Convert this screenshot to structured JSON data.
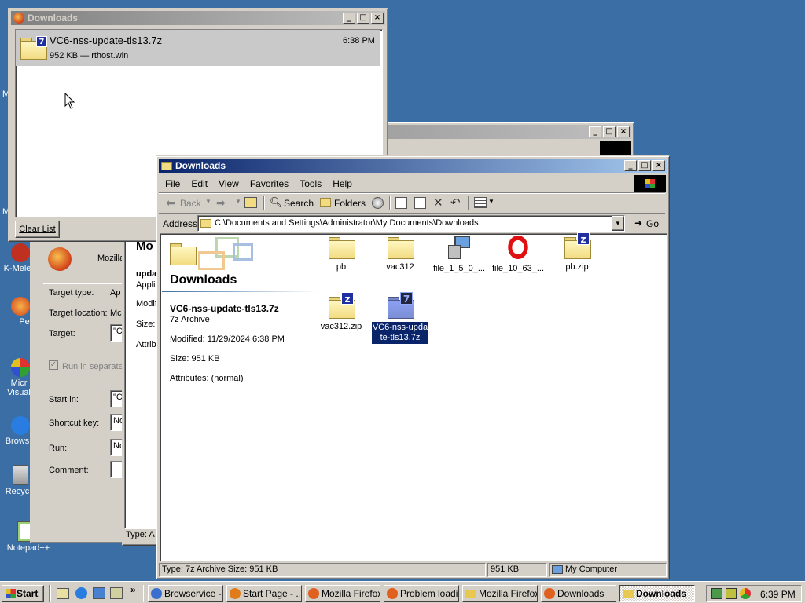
{
  "desktop": {
    "icons": [
      {
        "label": "K-Mele"
      },
      {
        "label": "Pe"
      },
      {
        "label": "Micr Visual"
      },
      {
        "label": "Brows"
      },
      {
        "label": "Recyc"
      },
      {
        "label": "Notepad++"
      }
    ],
    "edge_letters": [
      "M",
      "M"
    ]
  },
  "downloads_manager": {
    "title": "Downloads",
    "item": {
      "name": "VC6-nss-update-tls13.7z",
      "details": "952 KB — rthost.win",
      "time": "6:38 PM"
    },
    "clear_button": "Clear List"
  },
  "properties_window": {
    "app_name": "Mozilla",
    "labels": {
      "target_type": "Target type:",
      "target_location": "Target location:",
      "target": "Target:",
      "run_separate": "Run in separate",
      "start_in": "Start in:",
      "shortcut_key": "Shortcut key:",
      "run": "Run:",
      "comment": "Comment:"
    },
    "values": {
      "target_type": "Ap",
      "target_location": "Mc",
      "target": "\"C",
      "start_in": "\"C",
      "shortcut_key": "No",
      "run": "No"
    }
  },
  "middle_window": {
    "heading": "Mo",
    "title": "upda",
    "type_short": "Applic",
    "modified_label": "Modif",
    "size_label": "Size:",
    "attributes_label": "Attrib",
    "status": "Type: A"
  },
  "explorer": {
    "title": "Downloads",
    "menu": [
      "File",
      "Edit",
      "View",
      "Favorites",
      "Tools",
      "Help"
    ],
    "toolbar": {
      "back": "Back",
      "search": "Search",
      "folders": "Folders"
    },
    "address_label": "Address",
    "address_value": "C:\\Documents and Settings\\Administrator\\My Documents\\Downloads",
    "go_label": "Go",
    "left_panel": {
      "folder_title": "Downloads",
      "file_name": "VC6-nss-update-tls13.7z",
      "file_type": "7z Archive",
      "modified": "Modified: 11/29/2024 6:38 PM",
      "size": "Size: 951 KB",
      "attributes": "Attributes: (normal)"
    },
    "files": [
      {
        "name": "pb",
        "kind": "folder"
      },
      {
        "name": "vac312",
        "kind": "folder"
      },
      {
        "name": "file_1_5_0_...",
        "kind": "installer"
      },
      {
        "name": "file_10_63_...",
        "kind": "opera"
      },
      {
        "name": "pb.zip",
        "kind": "zip"
      },
      {
        "name": "vac312.zip",
        "kind": "zip"
      },
      {
        "name": "VC6-nss-update-tls13.7z",
        "kind": "7z",
        "selected": true
      }
    ],
    "statusbar": {
      "left": "Type: 7z Archive Size: 951 KB",
      "size": "951 KB",
      "zone": "My Computer"
    }
  },
  "taskbar": {
    "start": "Start",
    "items": [
      {
        "label": "Browservice - ...",
        "icon_color": "#3a6fd0"
      },
      {
        "label": "Start Page - ...",
        "icon_color": "#e07b1a"
      },
      {
        "label": "Mozilla Firefox",
        "icon_color": "#e06020"
      },
      {
        "label": "Problem loadi...",
        "icon_color": "#e06020"
      },
      {
        "label": "Mozilla Firefox",
        "icon_color": "#e8c850"
      },
      {
        "label": "Downloads",
        "icon_color": "#e06020"
      },
      {
        "label": "Downloads",
        "icon_color": "#e8c850",
        "pressed": true
      }
    ],
    "clock": "6:39 PM"
  }
}
